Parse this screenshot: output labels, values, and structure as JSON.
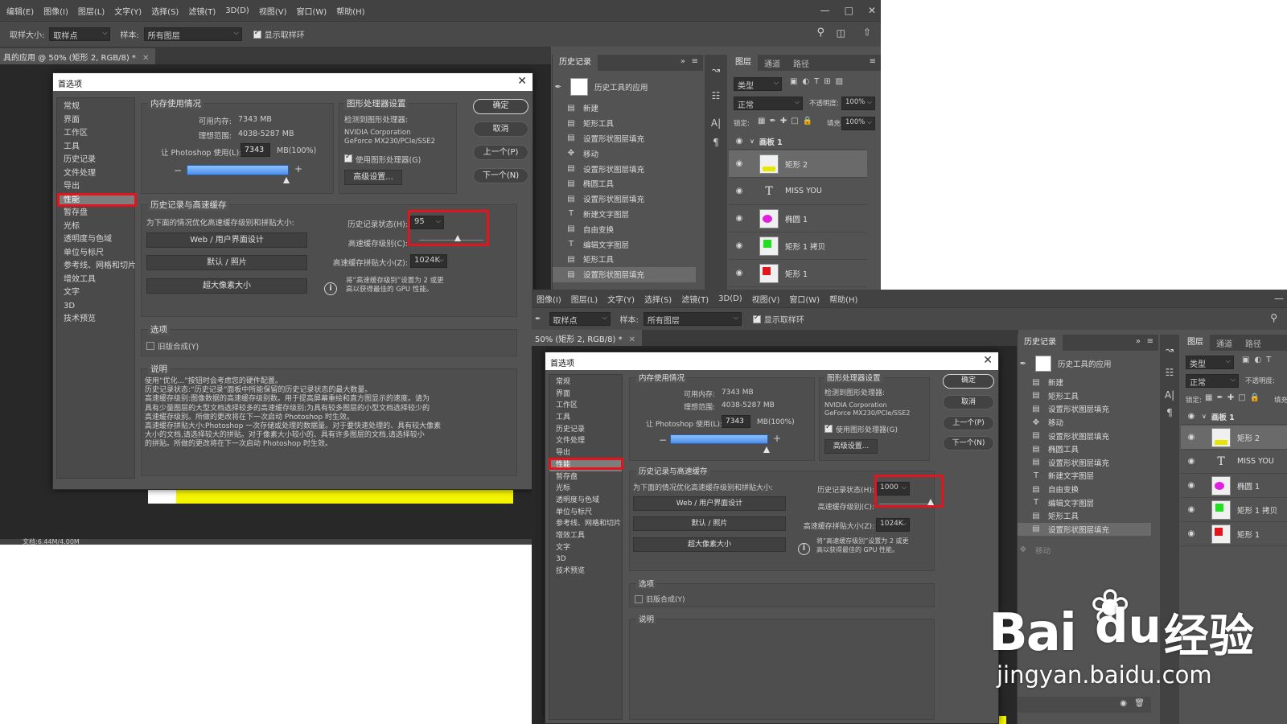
{
  "menu": [
    "编辑(E)",
    "图像(I)",
    "图层(L)",
    "文字(Y)",
    "选择(S)",
    "滤镜(T)",
    "3D(D)",
    "视图(V)",
    "窗口(W)",
    "帮助(H)"
  ],
  "menu2": [
    "图像(I)",
    "图层(L)",
    "文字(Y)",
    "选择(S)",
    "滤镜(T)",
    "3D(D)",
    "视图(V)",
    "窗口(W)",
    "帮助(H)"
  ],
  "options": {
    "sample_size_label": "取样大小:",
    "sample_size_value": "取样点",
    "sample_label": "样本:",
    "sample_value": "所有图层",
    "show_ring": "显示取样环"
  },
  "doc_tab1": "具的应用 @ 50% (矩形 2, RGB/8) *",
  "doc_tab2": "50% (矩形 2, RGB/8) *",
  "status_left": "文档:6.44M/4.00M",
  "dialog": {
    "title": "首选项",
    "categories": [
      "常规",
      "界面",
      "工作区",
      "工具",
      "历史记录",
      "文件处理",
      "导出",
      "性能",
      "暂存盘",
      "光标",
      "透明度与色域",
      "单位与标尺",
      "参考线、网格和切片",
      "增效工具",
      "文字",
      "3D",
      "技术预览"
    ],
    "memory": {
      "title": "内存使用情况",
      "avail_label": "可用内存:",
      "avail_value": "7343 MB",
      "ideal_label": "理想范围:",
      "ideal_value": "4038-5287 MB",
      "let_label": "让 Photoshop 使用(L):",
      "let_value": "7343",
      "let_unit": "MB(100%)",
      "minus": "−",
      "plus": "+"
    },
    "gpu": {
      "title": "图形处理器设置",
      "detected_label": "检测到图形处理器:",
      "gpu_name1": "NVIDIA Corporation",
      "gpu_name2": "GeForce MX230/PCIe/SSE2",
      "use_gpu": "使用图形处理器(G)",
      "advanced": "高级设置..."
    },
    "buttons": {
      "ok": "确定",
      "cancel": "取消",
      "prev": "上一个(P)",
      "next": "下一个(N)"
    },
    "history_cache": {
      "title": "历史记录与高速缓存",
      "optimize_label": "为下面的情况优化高速缓存级别和拼贴大小:",
      "btn_web": "Web / 用户界面设计",
      "btn_default": "默认 / 照片",
      "btn_huge": "超大像素大小",
      "states_label": "历史记录状态(H):",
      "states_value_1": "95",
      "states_value_2": "1000",
      "cache_levels_label": "高速缓存级别(C):",
      "tile_label": "高速缓存拼贴大小(Z):",
      "tile_value": "1024K",
      "hint_line1": "将“高速缓存级别”设置为 2 或更",
      "hint_line2": "高以获得最佳的 GPU 性能。"
    },
    "options": {
      "title": "选项",
      "legacy": "旧版合成(Y)"
    },
    "description": {
      "title": "说明",
      "lines": [
        "使用“优化...”按钮时会考虑您的硬件配置。",
        "历史记录状态:“历史记录”面板中所能保留的历史记录状态的最大数量。",
        "高速缓存级别:图像数据的高速缓存级别数。用于提高屏幕重绘和直方图显示的速度。请为",
        "具有少量图层的大型文档选择较多的高速缓存级别;为具有较多图层的小型文档选择较少的",
        "高速缓存级别。所做的更改将在下一次启动 Photoshop 时生效。",
        "高速缓存拼贴大小:Photoshop 一次存储或处理的数据量。对于要快速处理的、具有较大像素",
        "大小的文档,请选择较大的拼贴。对于像素大小较小的、具有许多图层的文档,请选择较小",
        "的拼贴。所做的更改将在下一次启动 Photoshop 时生效。"
      ]
    }
  },
  "history": {
    "tab": "历史记录",
    "snapshot": "历史工具的应用",
    "items": [
      "新建",
      "矩形工具",
      "设置形状图层填充",
      "移动",
      "设置形状图层填充",
      "椭圆工具",
      "设置形状图层填充",
      "新建文字图层",
      "自由变换",
      "编辑文字图层",
      "矩形工具",
      "设置形状图层填充"
    ],
    "extra_item": "移动"
  },
  "layers": {
    "tabs": [
      "图层",
      "通道",
      "路径"
    ],
    "kind_placeholder": "类型",
    "blend": "正常",
    "opacity_label": "不透明度:",
    "opacity_value": "100%",
    "lock_label": "锁定:",
    "fill_label": "填充:",
    "fill_value": "100%",
    "artboard": "画板 1",
    "items": [
      "矩形 2",
      "MISS YOU",
      "椭圆 1",
      "矩形 1 拷贝",
      "矩形 1"
    ]
  },
  "watermark": {
    "brand": "Bai",
    "brand2": "经验",
    "url": "jingyan.baidu.com"
  },
  "colors": {
    "highlight_red": "#e3141b",
    "canvas_yellow": "#f5f500",
    "bar_blue": "#4d8ee8",
    "panel_bg": "#535353"
  }
}
